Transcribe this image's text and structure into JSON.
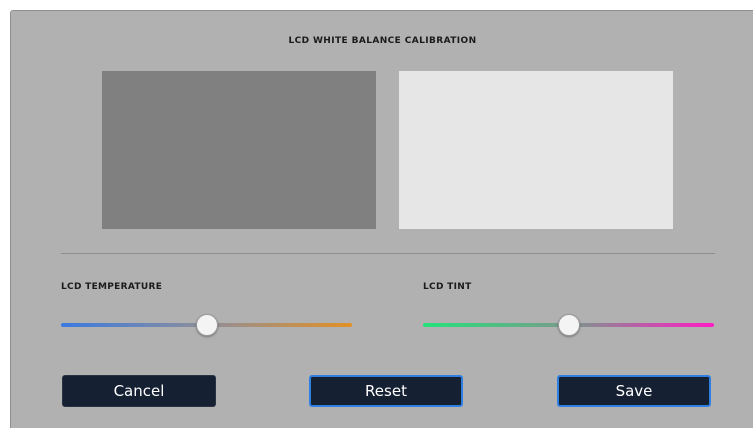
{
  "dialog": {
    "title": "LCD WHITE BALANCE CALIBRATION",
    "swatches": {
      "left_color": "#808080",
      "right_color": "#e6e6e6"
    }
  },
  "sliders": {
    "temperature": {
      "label": "LCD TEMPERATURE",
      "value_fraction": 0.5,
      "colors": [
        "#3a7ae0",
        "#8f8f9a",
        "#e39024"
      ]
    },
    "tint": {
      "label": "LCD TINT",
      "value_fraction": 0.5,
      "colors": [
        "#25e27a",
        "#7a9a8c",
        "#ff1cc5"
      ]
    }
  },
  "buttons": {
    "cancel": "Cancel",
    "reset": "Reset",
    "save": "Save"
  },
  "colors": {
    "panel_bg": "#b1b1b1",
    "button_bg": "#162033",
    "focus_border": "#2f7fe0"
  }
}
